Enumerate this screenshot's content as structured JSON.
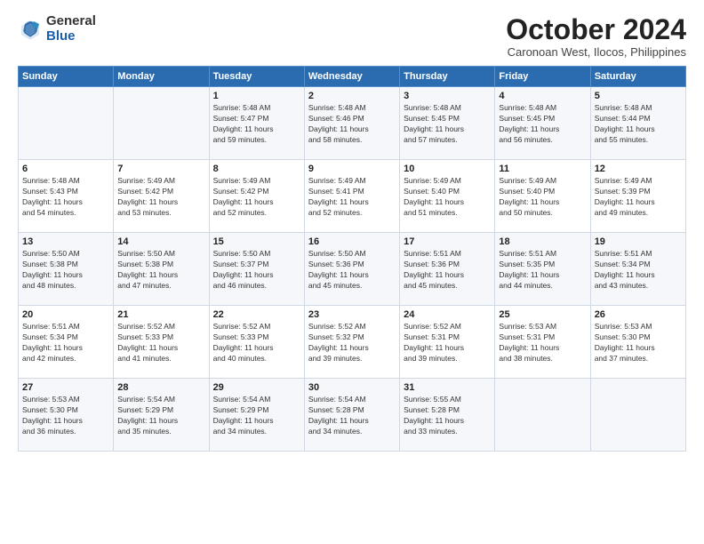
{
  "logo": {
    "general": "General",
    "blue": "Blue"
  },
  "title": "October 2024",
  "subtitle": "Caronoan West, Ilocos, Philippines",
  "headers": [
    "Sunday",
    "Monday",
    "Tuesday",
    "Wednesday",
    "Thursday",
    "Friday",
    "Saturday"
  ],
  "rows": [
    [
      {
        "day": "",
        "detail": ""
      },
      {
        "day": "",
        "detail": ""
      },
      {
        "day": "1",
        "detail": "Sunrise: 5:48 AM\nSunset: 5:47 PM\nDaylight: 11 hours\nand 59 minutes."
      },
      {
        "day": "2",
        "detail": "Sunrise: 5:48 AM\nSunset: 5:46 PM\nDaylight: 11 hours\nand 58 minutes."
      },
      {
        "day": "3",
        "detail": "Sunrise: 5:48 AM\nSunset: 5:45 PM\nDaylight: 11 hours\nand 57 minutes."
      },
      {
        "day": "4",
        "detail": "Sunrise: 5:48 AM\nSunset: 5:45 PM\nDaylight: 11 hours\nand 56 minutes."
      },
      {
        "day": "5",
        "detail": "Sunrise: 5:48 AM\nSunset: 5:44 PM\nDaylight: 11 hours\nand 55 minutes."
      }
    ],
    [
      {
        "day": "6",
        "detail": "Sunrise: 5:48 AM\nSunset: 5:43 PM\nDaylight: 11 hours\nand 54 minutes."
      },
      {
        "day": "7",
        "detail": "Sunrise: 5:49 AM\nSunset: 5:42 PM\nDaylight: 11 hours\nand 53 minutes."
      },
      {
        "day": "8",
        "detail": "Sunrise: 5:49 AM\nSunset: 5:42 PM\nDaylight: 11 hours\nand 52 minutes."
      },
      {
        "day": "9",
        "detail": "Sunrise: 5:49 AM\nSunset: 5:41 PM\nDaylight: 11 hours\nand 52 minutes."
      },
      {
        "day": "10",
        "detail": "Sunrise: 5:49 AM\nSunset: 5:40 PM\nDaylight: 11 hours\nand 51 minutes."
      },
      {
        "day": "11",
        "detail": "Sunrise: 5:49 AM\nSunset: 5:40 PM\nDaylight: 11 hours\nand 50 minutes."
      },
      {
        "day": "12",
        "detail": "Sunrise: 5:49 AM\nSunset: 5:39 PM\nDaylight: 11 hours\nand 49 minutes."
      }
    ],
    [
      {
        "day": "13",
        "detail": "Sunrise: 5:50 AM\nSunset: 5:38 PM\nDaylight: 11 hours\nand 48 minutes."
      },
      {
        "day": "14",
        "detail": "Sunrise: 5:50 AM\nSunset: 5:38 PM\nDaylight: 11 hours\nand 47 minutes."
      },
      {
        "day": "15",
        "detail": "Sunrise: 5:50 AM\nSunset: 5:37 PM\nDaylight: 11 hours\nand 46 minutes."
      },
      {
        "day": "16",
        "detail": "Sunrise: 5:50 AM\nSunset: 5:36 PM\nDaylight: 11 hours\nand 45 minutes."
      },
      {
        "day": "17",
        "detail": "Sunrise: 5:51 AM\nSunset: 5:36 PM\nDaylight: 11 hours\nand 45 minutes."
      },
      {
        "day": "18",
        "detail": "Sunrise: 5:51 AM\nSunset: 5:35 PM\nDaylight: 11 hours\nand 44 minutes."
      },
      {
        "day": "19",
        "detail": "Sunrise: 5:51 AM\nSunset: 5:34 PM\nDaylight: 11 hours\nand 43 minutes."
      }
    ],
    [
      {
        "day": "20",
        "detail": "Sunrise: 5:51 AM\nSunset: 5:34 PM\nDaylight: 11 hours\nand 42 minutes."
      },
      {
        "day": "21",
        "detail": "Sunrise: 5:52 AM\nSunset: 5:33 PM\nDaylight: 11 hours\nand 41 minutes."
      },
      {
        "day": "22",
        "detail": "Sunrise: 5:52 AM\nSunset: 5:33 PM\nDaylight: 11 hours\nand 40 minutes."
      },
      {
        "day": "23",
        "detail": "Sunrise: 5:52 AM\nSunset: 5:32 PM\nDaylight: 11 hours\nand 39 minutes."
      },
      {
        "day": "24",
        "detail": "Sunrise: 5:52 AM\nSunset: 5:31 PM\nDaylight: 11 hours\nand 39 minutes."
      },
      {
        "day": "25",
        "detail": "Sunrise: 5:53 AM\nSunset: 5:31 PM\nDaylight: 11 hours\nand 38 minutes."
      },
      {
        "day": "26",
        "detail": "Sunrise: 5:53 AM\nSunset: 5:30 PM\nDaylight: 11 hours\nand 37 minutes."
      }
    ],
    [
      {
        "day": "27",
        "detail": "Sunrise: 5:53 AM\nSunset: 5:30 PM\nDaylight: 11 hours\nand 36 minutes."
      },
      {
        "day": "28",
        "detail": "Sunrise: 5:54 AM\nSunset: 5:29 PM\nDaylight: 11 hours\nand 35 minutes."
      },
      {
        "day": "29",
        "detail": "Sunrise: 5:54 AM\nSunset: 5:29 PM\nDaylight: 11 hours\nand 34 minutes."
      },
      {
        "day": "30",
        "detail": "Sunrise: 5:54 AM\nSunset: 5:28 PM\nDaylight: 11 hours\nand 34 minutes."
      },
      {
        "day": "31",
        "detail": "Sunrise: 5:55 AM\nSunset: 5:28 PM\nDaylight: 11 hours\nand 33 minutes."
      },
      {
        "day": "",
        "detail": ""
      },
      {
        "day": "",
        "detail": ""
      }
    ]
  ]
}
